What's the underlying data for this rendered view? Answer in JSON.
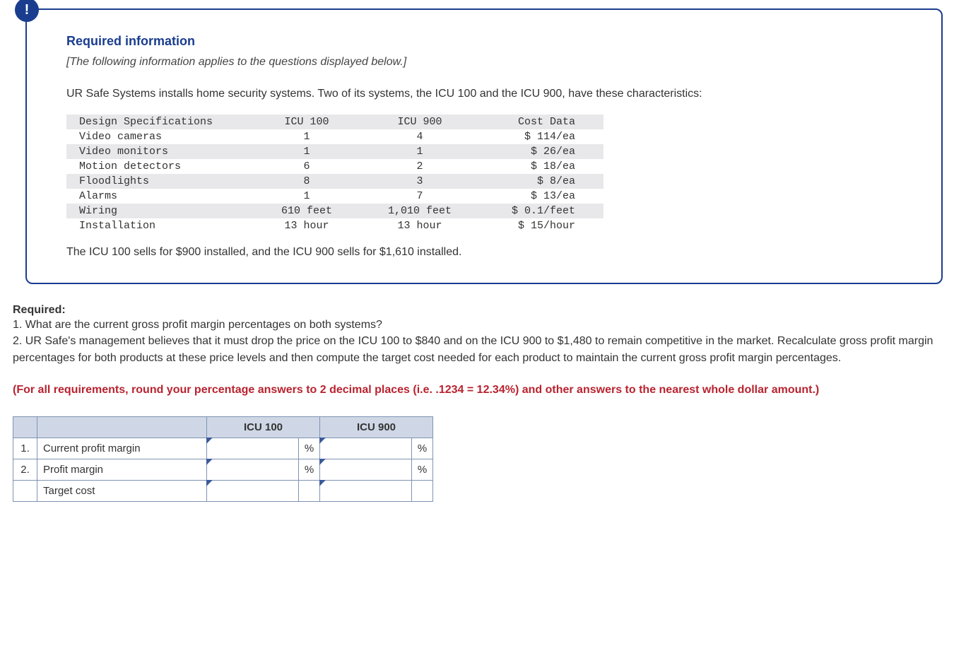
{
  "badge_label": "!",
  "section_title": "Required information",
  "italic_note": "[The following information applies to the questions displayed below.]",
  "intro": "UR Safe Systems installs home security systems. Two of its systems, the ICU 100 and the ICU 900, have these characteristics:",
  "spec_header": {
    "spec": "Design Specifications",
    "icu100": "ICU 100",
    "icu900": "ICU 900",
    "cost": "Cost Data"
  },
  "specs": [
    {
      "name": "Video cameras",
      "icu100": "1",
      "icu900": "4",
      "cost": "$ 114/ea"
    },
    {
      "name": "Video monitors",
      "icu100": "1",
      "icu900": "1",
      "cost": "$ 26/ea"
    },
    {
      "name": "Motion detectors",
      "icu100": "6",
      "icu900": "2",
      "cost": "$ 18/ea"
    },
    {
      "name": "Floodlights",
      "icu100": "8",
      "icu900": "3",
      "cost": "$ 8/ea"
    },
    {
      "name": "Alarms",
      "icu100": "1",
      "icu900": "7",
      "cost": "$ 13/ea"
    },
    {
      "name": "Wiring",
      "icu100": "610 feet",
      "icu900": "1,010 feet",
      "cost": "$ 0.1/feet"
    },
    {
      "name": "Installation",
      "icu100": "13 hour",
      "icu900": "13 hour",
      "cost": "$ 15/hour"
    }
  ],
  "sells_for": "The ICU 100 sells for $900 installed, and the ICU 900 sells for $1,610 installed.",
  "required_label": "Required:",
  "q1": "1. What are the current gross profit margin percentages on both systems?",
  "q2": "2. UR Safe's management believes that it must drop the price on the ICU 100 to $840 and on the ICU 900 to $1,480 to remain competitive in the market. Recalculate gross profit margin percentages for both products at these price levels and then compute the target cost needed for each product to maintain the current gross profit margin percentages.",
  "red_instruction": "(For all requirements, round your percentage answers to 2 decimal places (i.e. .1234 = 12.34%) and other answers to the nearest whole dollar amount.)",
  "answer_headers": {
    "icu100": "ICU 100",
    "icu900": "ICU 900"
  },
  "answer_rows": [
    {
      "num": "1.",
      "label": "Current profit margin",
      "unit": "%"
    },
    {
      "num": "2.",
      "label": "Profit margin",
      "unit": "%"
    },
    {
      "num": "",
      "label": "Target cost",
      "unit": ""
    }
  ]
}
